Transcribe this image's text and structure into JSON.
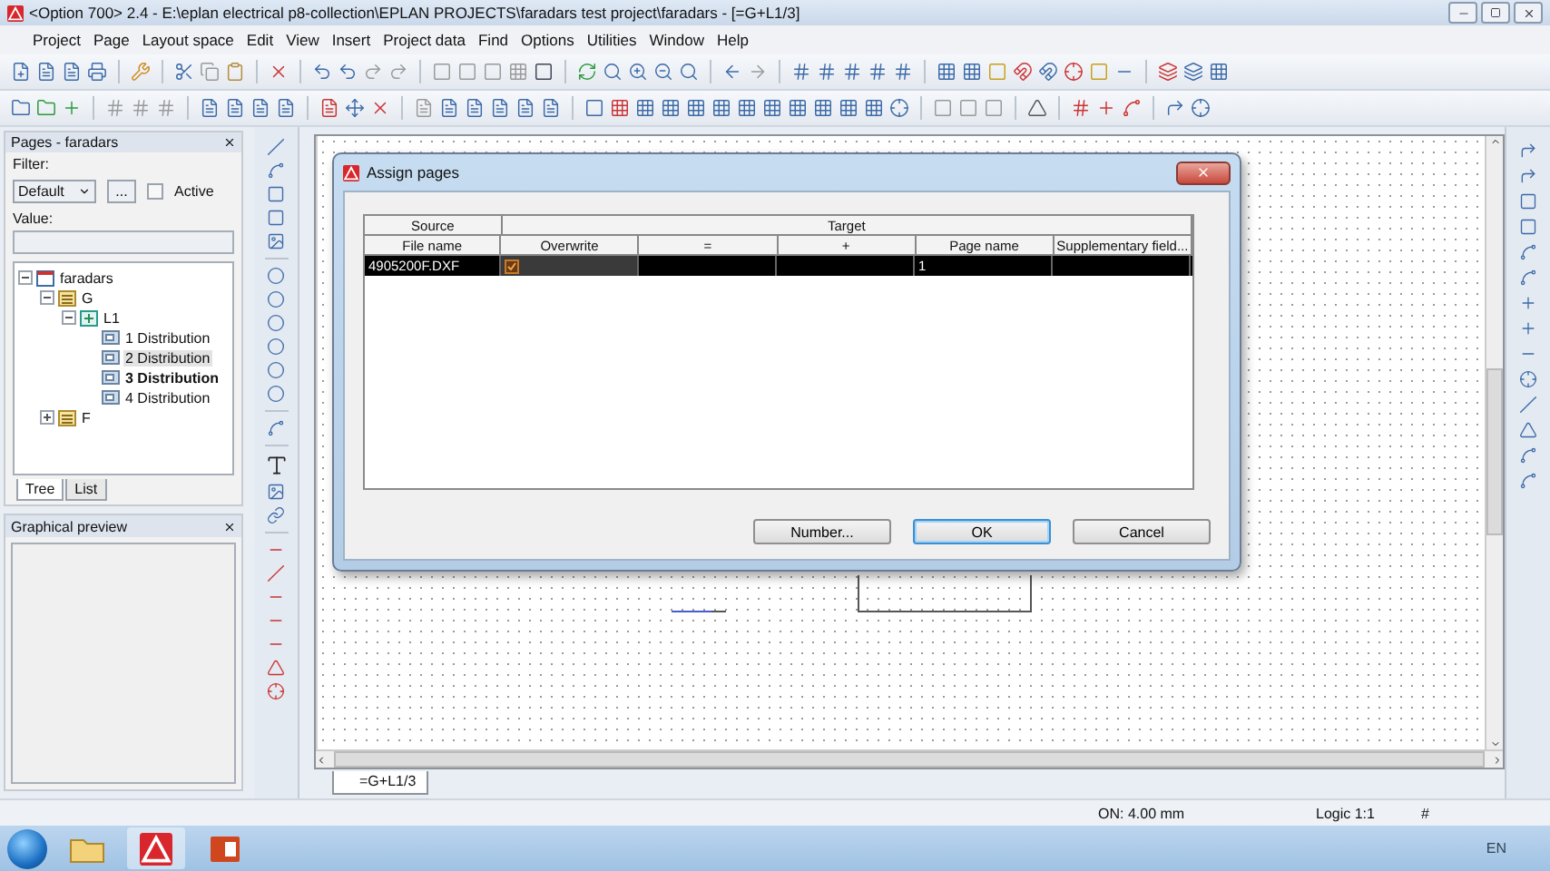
{
  "window": {
    "title": "<Option 700> 2.4 - E:\\eplan electrical p8-collection\\EPLAN PROJECTS\\faradars test project\\faradars - [=G+L1/3]"
  },
  "menu": [
    "Project",
    "Page",
    "Layout space",
    "Edit",
    "View",
    "Insert",
    "Project data",
    "Find",
    "Options",
    "Utilities",
    "Window",
    "Help"
  ],
  "pages_panel": {
    "title": "Pages - faradars",
    "filter_label": "Filter:",
    "filter_value": "Default",
    "more_button": "...",
    "active": {
      "label": "Active",
      "checked": false
    },
    "value_label": "Value:",
    "tree": [
      {
        "label": "faradars",
        "kind": "project",
        "expanded": true,
        "selected": false,
        "current": false,
        "children": [
          {
            "label": "G",
            "kind": "structure",
            "expanded": true,
            "selected": false,
            "current": false,
            "children": [
              {
                "label": "L1",
                "kind": "location",
                "expanded": true,
                "selected": false,
                "current": false,
                "children": [
                  {
                    "label": "1 Distribution",
                    "kind": "page",
                    "selected": false,
                    "current": false
                  },
                  {
                    "label": "2 Distribution",
                    "kind": "page",
                    "selected": true,
                    "current": false
                  },
                  {
                    "label": "3 Distribution",
                    "kind": "page",
                    "selected": false,
                    "current": true
                  },
                  {
                    "label": "4 Distribution",
                    "kind": "page",
                    "selected": false,
                    "current": false
                  }
                ]
              }
            ]
          },
          {
            "label": "F",
            "kind": "structure",
            "expanded": false,
            "selected": false,
            "current": false
          }
        ]
      }
    ],
    "tabs": [
      {
        "label": "Tree",
        "selected": true
      },
      {
        "label": "List",
        "selected": false
      }
    ]
  },
  "preview_panel": {
    "title": "Graphical preview"
  },
  "canvas": {
    "page_tab": "=G+L1/3"
  },
  "dialog": {
    "title": "Assign pages",
    "groups": [
      "Source",
      "Target"
    ],
    "columns": [
      "File name",
      "Overwrite",
      "=",
      "+",
      "Page name",
      "Supplementary field..."
    ],
    "rows": [
      {
        "selected": true,
        "file_name": "4905200F.DXF",
        "overwrite": true,
        "page_name": "1"
      }
    ],
    "buttons": [
      {
        "label": "Number...",
        "default": false
      },
      {
        "label": "OK",
        "default": true
      },
      {
        "label": "Cancel",
        "default": false
      }
    ]
  },
  "status_bar": [
    "ON: 4.00 mm",
    "Logic 1:1",
    "#"
  ],
  "taskbar": {
    "language": "EN"
  }
}
